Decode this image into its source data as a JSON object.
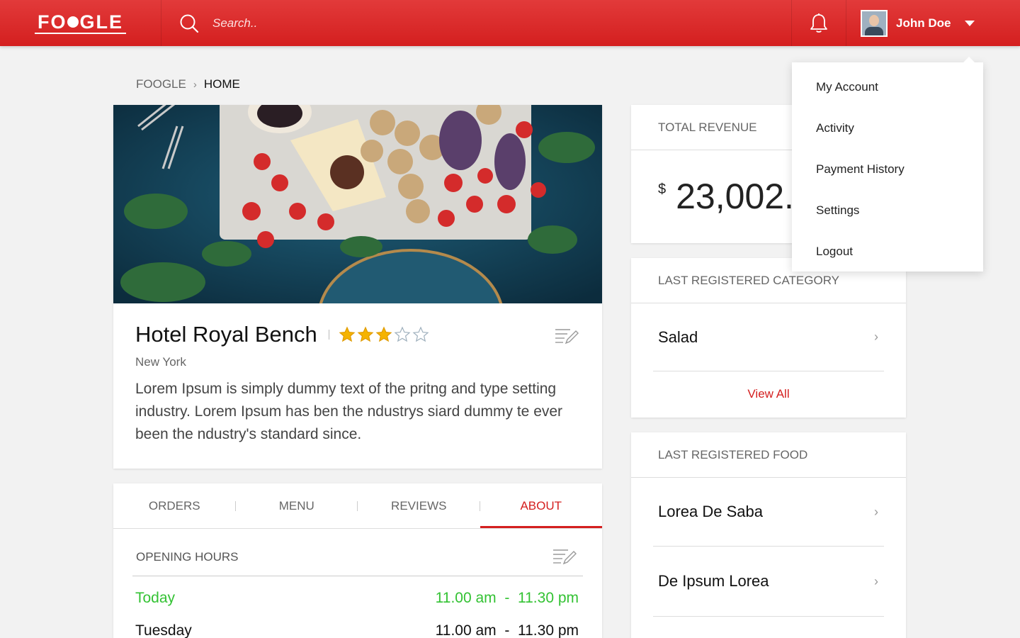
{
  "header": {
    "logo": "FOOGLE",
    "search_placeholder": "Search..",
    "user_name": "John Doe"
  },
  "breadcrumb": {
    "root": "FOOGLE",
    "current": "HOME"
  },
  "hotel": {
    "name": "Hotel Royal Bench",
    "rating": 3,
    "rating_max": 5,
    "city": "New York",
    "description": "Lorem Ipsum is simply dummy text of the pritng and type setting industry. Lorem Ipsum has ben the ndustrys siard dummy te ever been the ndustry's standard since."
  },
  "tabs": [
    {
      "label": "ORDERS",
      "active": false
    },
    {
      "label": "MENU",
      "active": false
    },
    {
      "label": "REVIEWS",
      "active": false
    },
    {
      "label": "ABOUT",
      "active": true
    }
  ],
  "opening_hours": {
    "title": "OPENING HOURS",
    "rows": [
      {
        "day": "Today",
        "open": "11.00 am",
        "sep": "-",
        "close": "11.30 pm"
      },
      {
        "day": "Tuesday",
        "open": "11.00 am",
        "sep": "-",
        "close": "11.30 pm"
      }
    ]
  },
  "revenue": {
    "title": "TOTAL REVENUE",
    "currency": "$",
    "amount": "23,002."
  },
  "category": {
    "title": "LAST REGISTERED CATEGORY",
    "items": [
      "Salad"
    ],
    "view_all": "View All"
  },
  "food": {
    "title": "LAST REGISTERED FOOD",
    "items": [
      "Lorea De Saba",
      "De Ipsum Lorea"
    ]
  },
  "dropdown": {
    "items": [
      "My Account",
      "Activity",
      "Payment History",
      "Settings",
      "Logout"
    ]
  },
  "colors": {
    "primary": "#d41f1f",
    "open_today": "#33c233",
    "star_filled": "#f5b301"
  }
}
